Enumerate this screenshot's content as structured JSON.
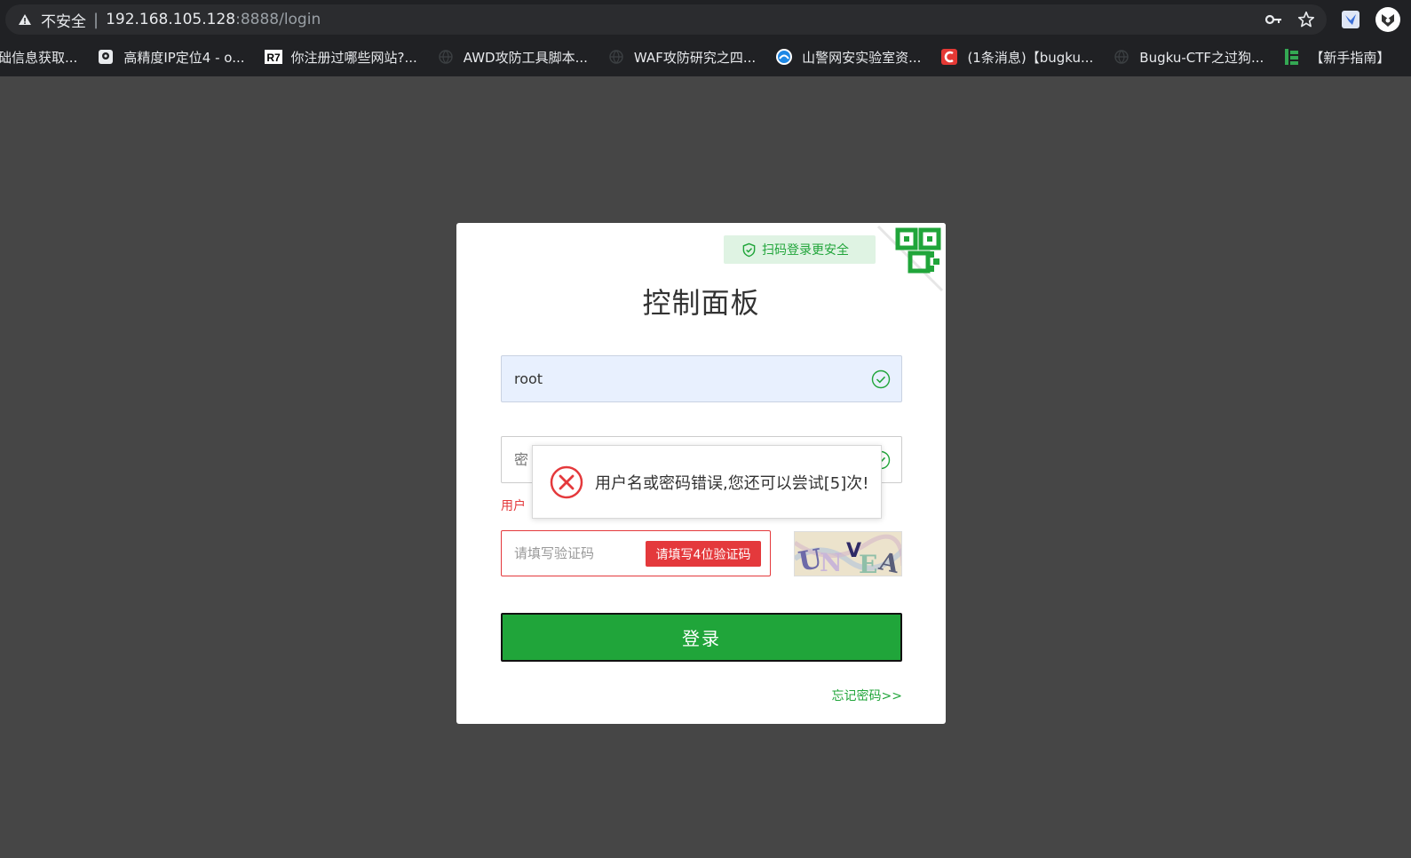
{
  "browser": {
    "insecure_label": "不安全",
    "separator": "|",
    "url_host": "192.168.105.128",
    "url_rest": ":8888/login",
    "bookmarks": [
      {
        "label": "础信息获取...",
        "icon": "generic-icon"
      },
      {
        "label": "高精度IP定位4 - o...",
        "icon": "map-pin-icon"
      },
      {
        "label": "你注册过哪些网站?...",
        "icon": "r7-logo-icon"
      },
      {
        "label": "AWD攻防工具脚本...",
        "icon": "globe-icon"
      },
      {
        "label": "WAF攻防研究之四...",
        "icon": "globe-icon"
      },
      {
        "label": "山警网安实验室资...",
        "icon": "circle-logo-icon"
      },
      {
        "label": "(1条消息)【bugku...",
        "icon": "csdn-icon"
      },
      {
        "label": "Bugku-CTF之过狗...",
        "icon": "globe-icon"
      },
      {
        "label": "【新手指南】",
        "icon": "green-bars-icon"
      }
    ]
  },
  "login": {
    "qr_tip": "扫码登录更安全",
    "title": "控制面板",
    "username_value": "root",
    "password_placeholder": "密",
    "error_text": "用户",
    "captcha_placeholder": "请填写验证码",
    "captcha_error": "请填写4位验证码",
    "captcha_image_text": "UNVEA",
    "login_button": "登录",
    "forgot_link": "忘记密码>>"
  },
  "toast": {
    "message": "用户名或密码错误,您还可以尝试[5]次!"
  },
  "colors": {
    "page_bg": "#464646",
    "brand_green": "#20a53a",
    "error_red": "#e4393c"
  }
}
